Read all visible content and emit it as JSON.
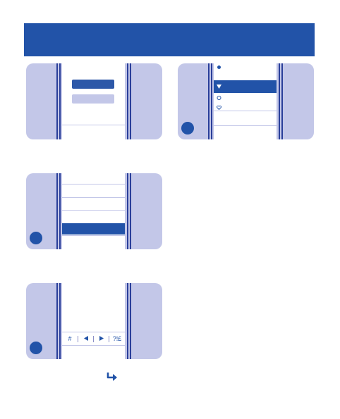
{
  "colors": {
    "brand_blue": "#2253a8",
    "panel_lavender": "#c3c7e8",
    "line_navy": "#2a3f9a"
  },
  "toolbar": {
    "hash_label": "#",
    "left_icon": "triangle-left-icon",
    "right_icon": "triangle-right-icon",
    "symbols_label": "?!£"
  },
  "footer": {
    "arrow_icon": "curved-arrow-right-icon"
  }
}
